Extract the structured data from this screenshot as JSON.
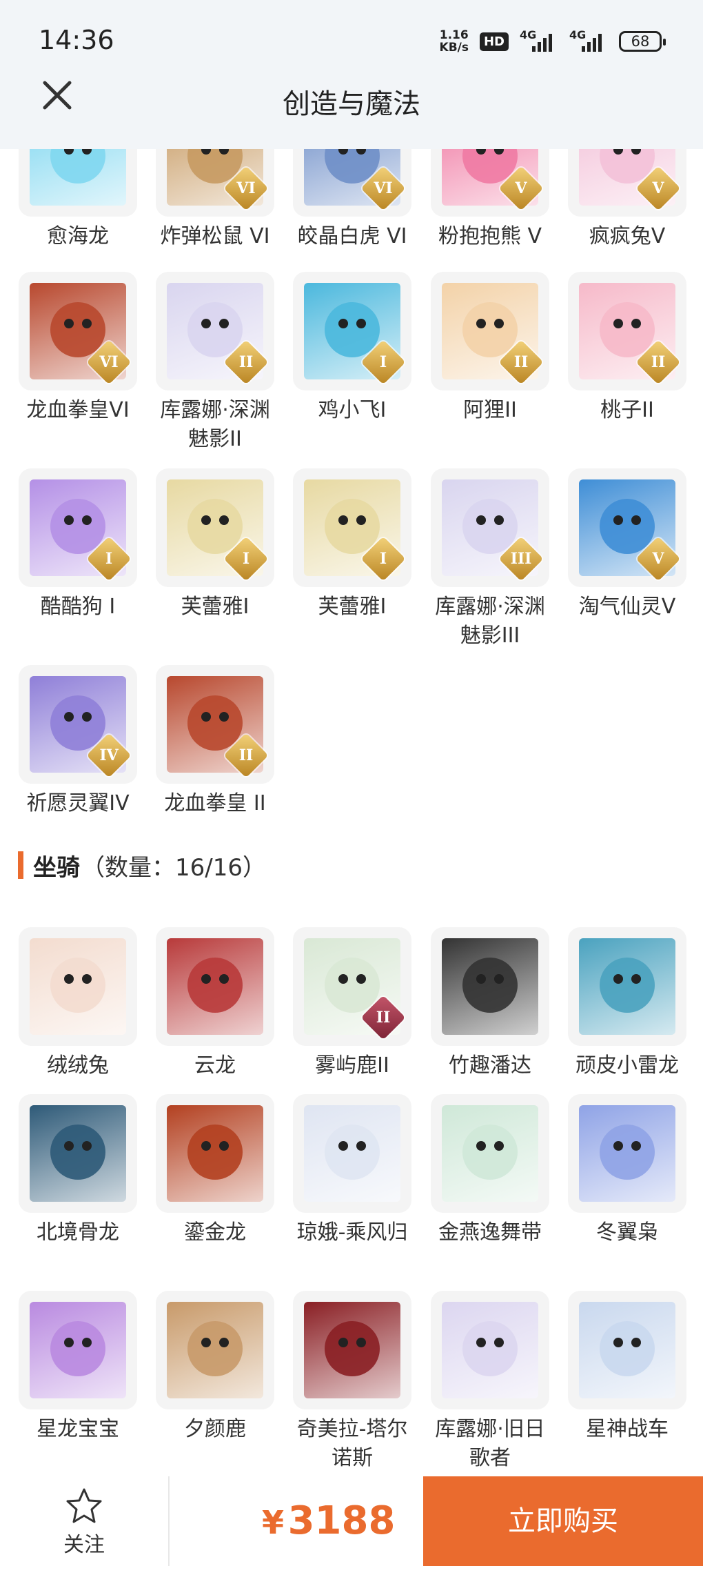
{
  "status": {
    "time": "14:36",
    "speed_top": "1.16",
    "speed_bottom": "KB/s",
    "hd": "HD",
    "net1": "4G",
    "net2": "4G",
    "battery": "68"
  },
  "header": {
    "title": "创造与魔法",
    "close_icon": "close-icon"
  },
  "pets": [
    {
      "label": "愈海龙",
      "badge": "",
      "color": "#7fd7f0"
    },
    {
      "label": "炸弹松鼠 VI",
      "badge": "VI",
      "color": "#c79a62"
    },
    {
      "label": "皎晶白虎 VI",
      "badge": "VI",
      "color": "#6f8fc8"
    },
    {
      "label": "粉抱抱熊 V",
      "badge": "V",
      "color": "#f07aa3"
    },
    {
      "label": "疯疯兔V",
      "badge": "V",
      "color": "#f3c1d8"
    },
    {
      "label": "龙血拳皇VI",
      "badge": "VI",
      "color": "#b8482e"
    },
    {
      "label": "库露娜·深渊魅影II",
      "badge": "II",
      "color": "#d9d5ef"
    },
    {
      "label": "鸡小飞I",
      "badge": "I",
      "color": "#4bb8dd"
    },
    {
      "label": "阿狸II",
      "badge": "II",
      "color": "#f3d2a8"
    },
    {
      "label": "桃子II",
      "badge": "II",
      "color": "#f6b9c9"
    },
    {
      "label": "酷酷狗 I",
      "badge": "I",
      "color": "#b490e6"
    },
    {
      "label": "芙蕾雅I",
      "badge": "I",
      "color": "#e7d9a2"
    },
    {
      "label": "芙蕾雅I",
      "badge": "I",
      "color": "#e7d9a2"
    },
    {
      "label": "库露娜·深渊魅影III",
      "badge": "III",
      "color": "#d9d5ef"
    },
    {
      "label": "淘气仙灵V",
      "badge": "V",
      "color": "#3f8ed6"
    },
    {
      "label": "祈愿灵翼IV",
      "badge": "IV",
      "color": "#8f7fd8"
    },
    {
      "label": "龙血拳皇 II",
      "badge": "II",
      "color": "#b8482e"
    }
  ],
  "mount_section": {
    "title": "坐骑",
    "count": "（数量：16/16）"
  },
  "mounts": [
    {
      "label": "绒绒兔",
      "badge": "",
      "color": "#f3dccf"
    },
    {
      "label": "云龙",
      "badge": "",
      "color": "#b83a3a"
    },
    {
      "label": "雾屿鹿II",
      "badge": "II",
      "color": "#d9e8d5"
    },
    {
      "label": "竹趣潘达",
      "badge": "",
      "color": "#333333"
    },
    {
      "label": "顽皮小雷龙",
      "badge": "",
      "color": "#4aa2bf"
    },
    {
      "label": "北境骨龙",
      "badge": "",
      "color": "#2e5a78"
    },
    {
      "label": "鎏金龙",
      "badge": "",
      "color": "#b34020"
    },
    {
      "label": "琼娥-乘风归",
      "badge": "",
      "color": "#dfe5f2"
    },
    {
      "label": "金燕逸舞带",
      "badge": "",
      "color": "#cfe8d8"
    },
    {
      "label": "冬翼枭",
      "badge": "",
      "color": "#8fa3e6"
    },
    {
      "label": "星龙宝宝",
      "badge": "",
      "color": "#b98ae0"
    },
    {
      "label": "夕颜鹿",
      "badge": "",
      "color": "#c89a6a"
    },
    {
      "label": "奇美拉-塔尔诺斯",
      "badge": "",
      "color": "#8a1f24"
    },
    {
      "label": "库露娜·旧日歌者",
      "badge": "",
      "color": "#dcd6f0"
    },
    {
      "label": "星神战车",
      "badge": "",
      "color": "#c9d8ee"
    }
  ],
  "footer": {
    "follow_label": "关注",
    "currency": "¥",
    "price": "3188",
    "buy_label": "立即购买"
  }
}
